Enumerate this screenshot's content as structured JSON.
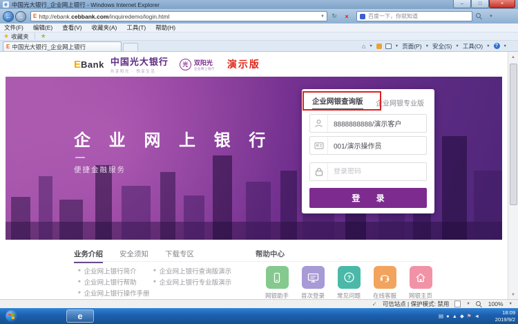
{
  "window": {
    "title": "中国光大银行_企业网上银行 - Windows Internet Explorer",
    "url_prefix": "http://ebank.",
    "url_domain": "cebbank.com",
    "url_path": "/inquiredemo/login.html",
    "search_text": "百度一下，你就知道",
    "menu_items": [
      "文件(F)",
      "编辑(E)",
      "查看(V)",
      "收藏夹(A)",
      "工具(T)",
      "帮助(H)"
    ],
    "favorites_label": "收藏夹",
    "tab_title": "中国光大银行_企业网上银行",
    "command_buttons": [
      "页面(P)",
      "安全(S)",
      "工具(O)"
    ]
  },
  "page": {
    "header": {
      "logo_e": "E",
      "logo_bank": "Bank",
      "bank_name": "中国光大银行",
      "tagline": "共享阳光 · 悦享生活",
      "badge_seal": "光",
      "badge_title": "双阳光",
      "badge_subtitle": "企业网上银行",
      "demo_label": "演示版"
    },
    "banner": {
      "hero_title": "企 业 网 上 银 行",
      "hero_subtitle": "便捷金融服务"
    },
    "login": {
      "tab_query": "企业网银查询版",
      "tab_pro": "企业网银专业版",
      "customer_value": "8888888888/演示客户",
      "operator_value": "001/演示操作员",
      "password_placeholder": "登录密码",
      "login_button": "登 录",
      "accent_color": "#7d2b8e",
      "annotation_color": "#e01f1f"
    },
    "info": {
      "nav_tabs": [
        "业务介绍",
        "安全须知",
        "下载专区"
      ],
      "help_center_label": "帮助中心",
      "links_col1": [
        "企业网上银行简介",
        "企业网上银行帮助",
        "企业网上银行操作手册"
      ],
      "links_col2": [
        "企业网上银行查询版演示",
        "企业网上银行专业版演示"
      ],
      "help_items": [
        {
          "label": "网银助手",
          "color": "#85c98f"
        },
        {
          "label": "首次登录",
          "color": "#a79ad6"
        },
        {
          "label": "常见问题",
          "color": "#4ab9a8"
        },
        {
          "label": "在线客服",
          "color": "#f2a45e"
        },
        {
          "label": "网银主页",
          "color": "#f192a6"
        }
      ]
    }
  },
  "status_bar": {
    "security_text": "可信站点 | 保护模式: 禁用",
    "zoom_level": "100%"
  },
  "taskbar": {
    "ie_glyph": "e",
    "time": "18:09",
    "date": "2019/9/2"
  }
}
